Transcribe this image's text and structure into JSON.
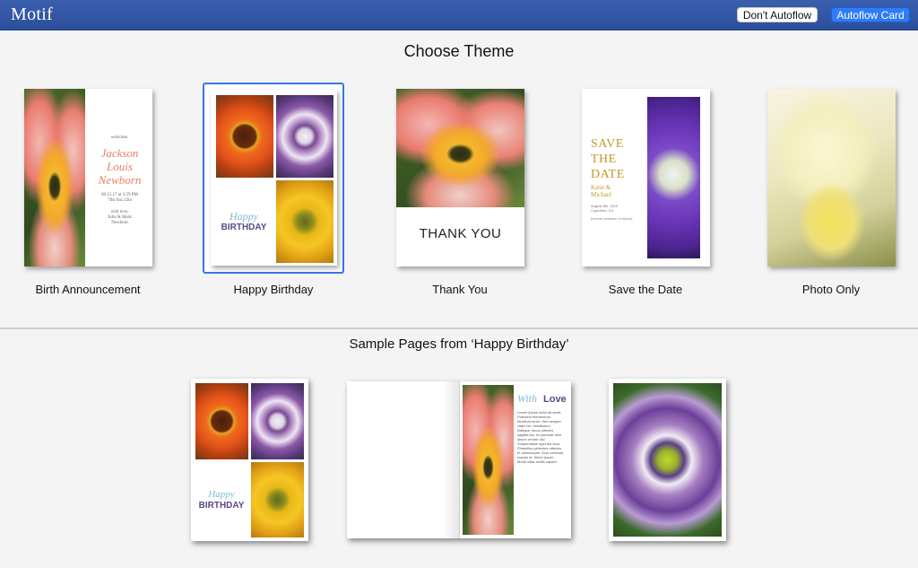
{
  "app": {
    "name": "Motif"
  },
  "toolbar": {
    "dont_autoflow_label": "Don't Autoflow",
    "autoflow_card_label": "Autoflow Card"
  },
  "themes_section": {
    "title": "Choose Theme",
    "selected": "Happy Birthday",
    "items": [
      {
        "label": "Birth Announcement",
        "card": {
          "welcome": "welcome,",
          "name_lines": [
            "Jackson",
            "Louis",
            "Newborn"
          ],
          "details": [
            "08.15.17 at 3:29 PM",
            "7lbs 6oz 22in"
          ],
          "closing": [
            "with love,",
            "Julia & Mark",
            "Newborn"
          ]
        }
      },
      {
        "label": "Happy Birthday",
        "card": {
          "script": "Happy",
          "bold": "BIRTHDAY"
        }
      },
      {
        "label": "Thank You",
        "card": {
          "text": "THANK YOU"
        }
      },
      {
        "label": "Save the Date",
        "card": {
          "heading_lines": [
            "SAVE",
            "THE",
            "DATE"
          ],
          "names": [
            "Katie &",
            "Michael"
          ],
          "detail": [
            "August 8th, 2019",
            "Cupertino, CA"
          ],
          "note": "(formal invitation to follow)"
        }
      },
      {
        "label": "Photo Only",
        "card": {}
      }
    ]
  },
  "sample_section": {
    "title": "Sample Pages from ‘Happy Birthday’",
    "pages": [
      {
        "script": "Happy",
        "bold": "BIRTHDAY"
      },
      {
        "script": "With",
        "bold": "Love",
        "lorem": "Lorem ipsum dolor sit amet. Praesent elementum tincidunt tortor. Sed semper vitae est. Vestibulum tristique, lacus ultricies sagittis leo, eu pulvinar sem ipsum ornare nisl. Suspendisse eget dui arcu. Phasellus pellentes ultricies et ullamcorper. Duis vehicula mauris ut. Morbi ipsum. Morbi vitae mollis sapien."
      },
      {}
    ]
  },
  "colors": {
    "titlebar": "#2f53a3",
    "accent": "#2f7cf6",
    "selection": "#3478e6",
    "birth_name": "#e87f63",
    "birthday_text": "#5a4a86",
    "save_date_gold": "#c39a2a"
  }
}
